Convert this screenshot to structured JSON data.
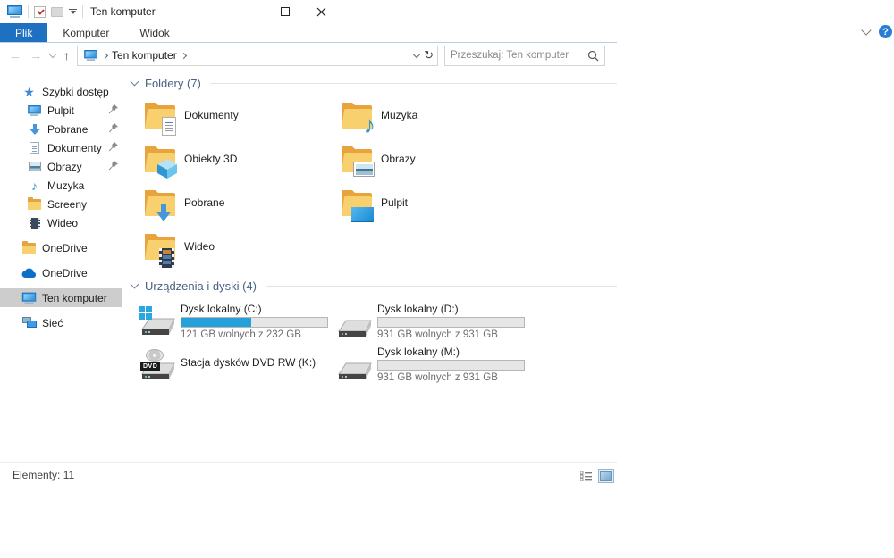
{
  "window": {
    "title": "Ten komputer"
  },
  "ribbon": {
    "tabs": [
      {
        "label": "Plik",
        "active": true
      },
      {
        "label": "Komputer",
        "active": false
      },
      {
        "label": "Widok",
        "active": false
      }
    ],
    "help_label": "?"
  },
  "addressbar": {
    "location": "Ten komputer",
    "refresh_glyph": "↻",
    "back_glyph": "←",
    "forward_glyph": "→",
    "up_glyph": "↑"
  },
  "search": {
    "placeholder": "Przeszukaj: Ten komputer"
  },
  "sidebar": {
    "items": [
      {
        "label": "Szybki dostęp",
        "icon": "star",
        "pinned": false
      },
      {
        "label": "Pulpit",
        "icon": "monitor",
        "pinned": true
      },
      {
        "label": "Pobrane",
        "icon": "download-arrow",
        "pinned": true
      },
      {
        "label": "Dokumenty",
        "icon": "document",
        "pinned": true
      },
      {
        "label": "Obrazy",
        "icon": "picture",
        "pinned": true
      },
      {
        "label": "Muzyka",
        "icon": "music-note",
        "pinned": false
      },
      {
        "label": "Screeny",
        "icon": "folder",
        "pinned": false
      },
      {
        "label": "Wideo",
        "icon": "film",
        "pinned": false
      },
      {
        "label": "OneDrive",
        "icon": "folder",
        "pinned": false
      },
      {
        "label": "OneDrive",
        "icon": "cloud",
        "pinned": false
      },
      {
        "label": "Ten komputer",
        "icon": "computer",
        "pinned": false,
        "selected": true
      },
      {
        "label": "Sieć",
        "icon": "network",
        "pinned": false
      }
    ]
  },
  "groups": {
    "folders_title": "Foldery (7)",
    "drives_title": "Urządzenia i dyski (4)"
  },
  "folders": [
    {
      "label": "Dokumenty",
      "overlay": "document"
    },
    {
      "label": "Muzyka",
      "overlay": "music-note"
    },
    {
      "label": "Obiekty 3D",
      "overlay": "cube"
    },
    {
      "label": "Obrazy",
      "overlay": "picture"
    },
    {
      "label": "Pobrane",
      "overlay": "download-arrow"
    },
    {
      "label": "Pulpit",
      "overlay": "monitor"
    },
    {
      "label": "Wideo",
      "overlay": "film"
    }
  ],
  "drives": [
    {
      "label": "Dysk lokalny (C:)",
      "free_text": "121 GB wolnych z 232 GB",
      "used_pct": 48,
      "kind": "system-drive"
    },
    {
      "label": "Dysk lokalny (D:)",
      "free_text": "931 GB wolnych z 931 GB",
      "used_pct": 0,
      "kind": "hard-drive"
    },
    {
      "label": "Stacja dysków DVD RW (K:)",
      "kind": "dvd-drive",
      "dvd_label": "DVD"
    },
    {
      "label": "Dysk lokalny (M:)",
      "free_text": "931 GB wolnych z 931 GB",
      "used_pct": 0,
      "kind": "hard-drive"
    }
  ],
  "statusbar": {
    "items_text": "Elementy: 11"
  },
  "colors": {
    "accent": "#1e70c1",
    "capacity_fill": "#26a0da",
    "selection_gray": "#cdcdcd",
    "group_header": "#4a6285",
    "folder_yellow": "#f8d16e"
  }
}
